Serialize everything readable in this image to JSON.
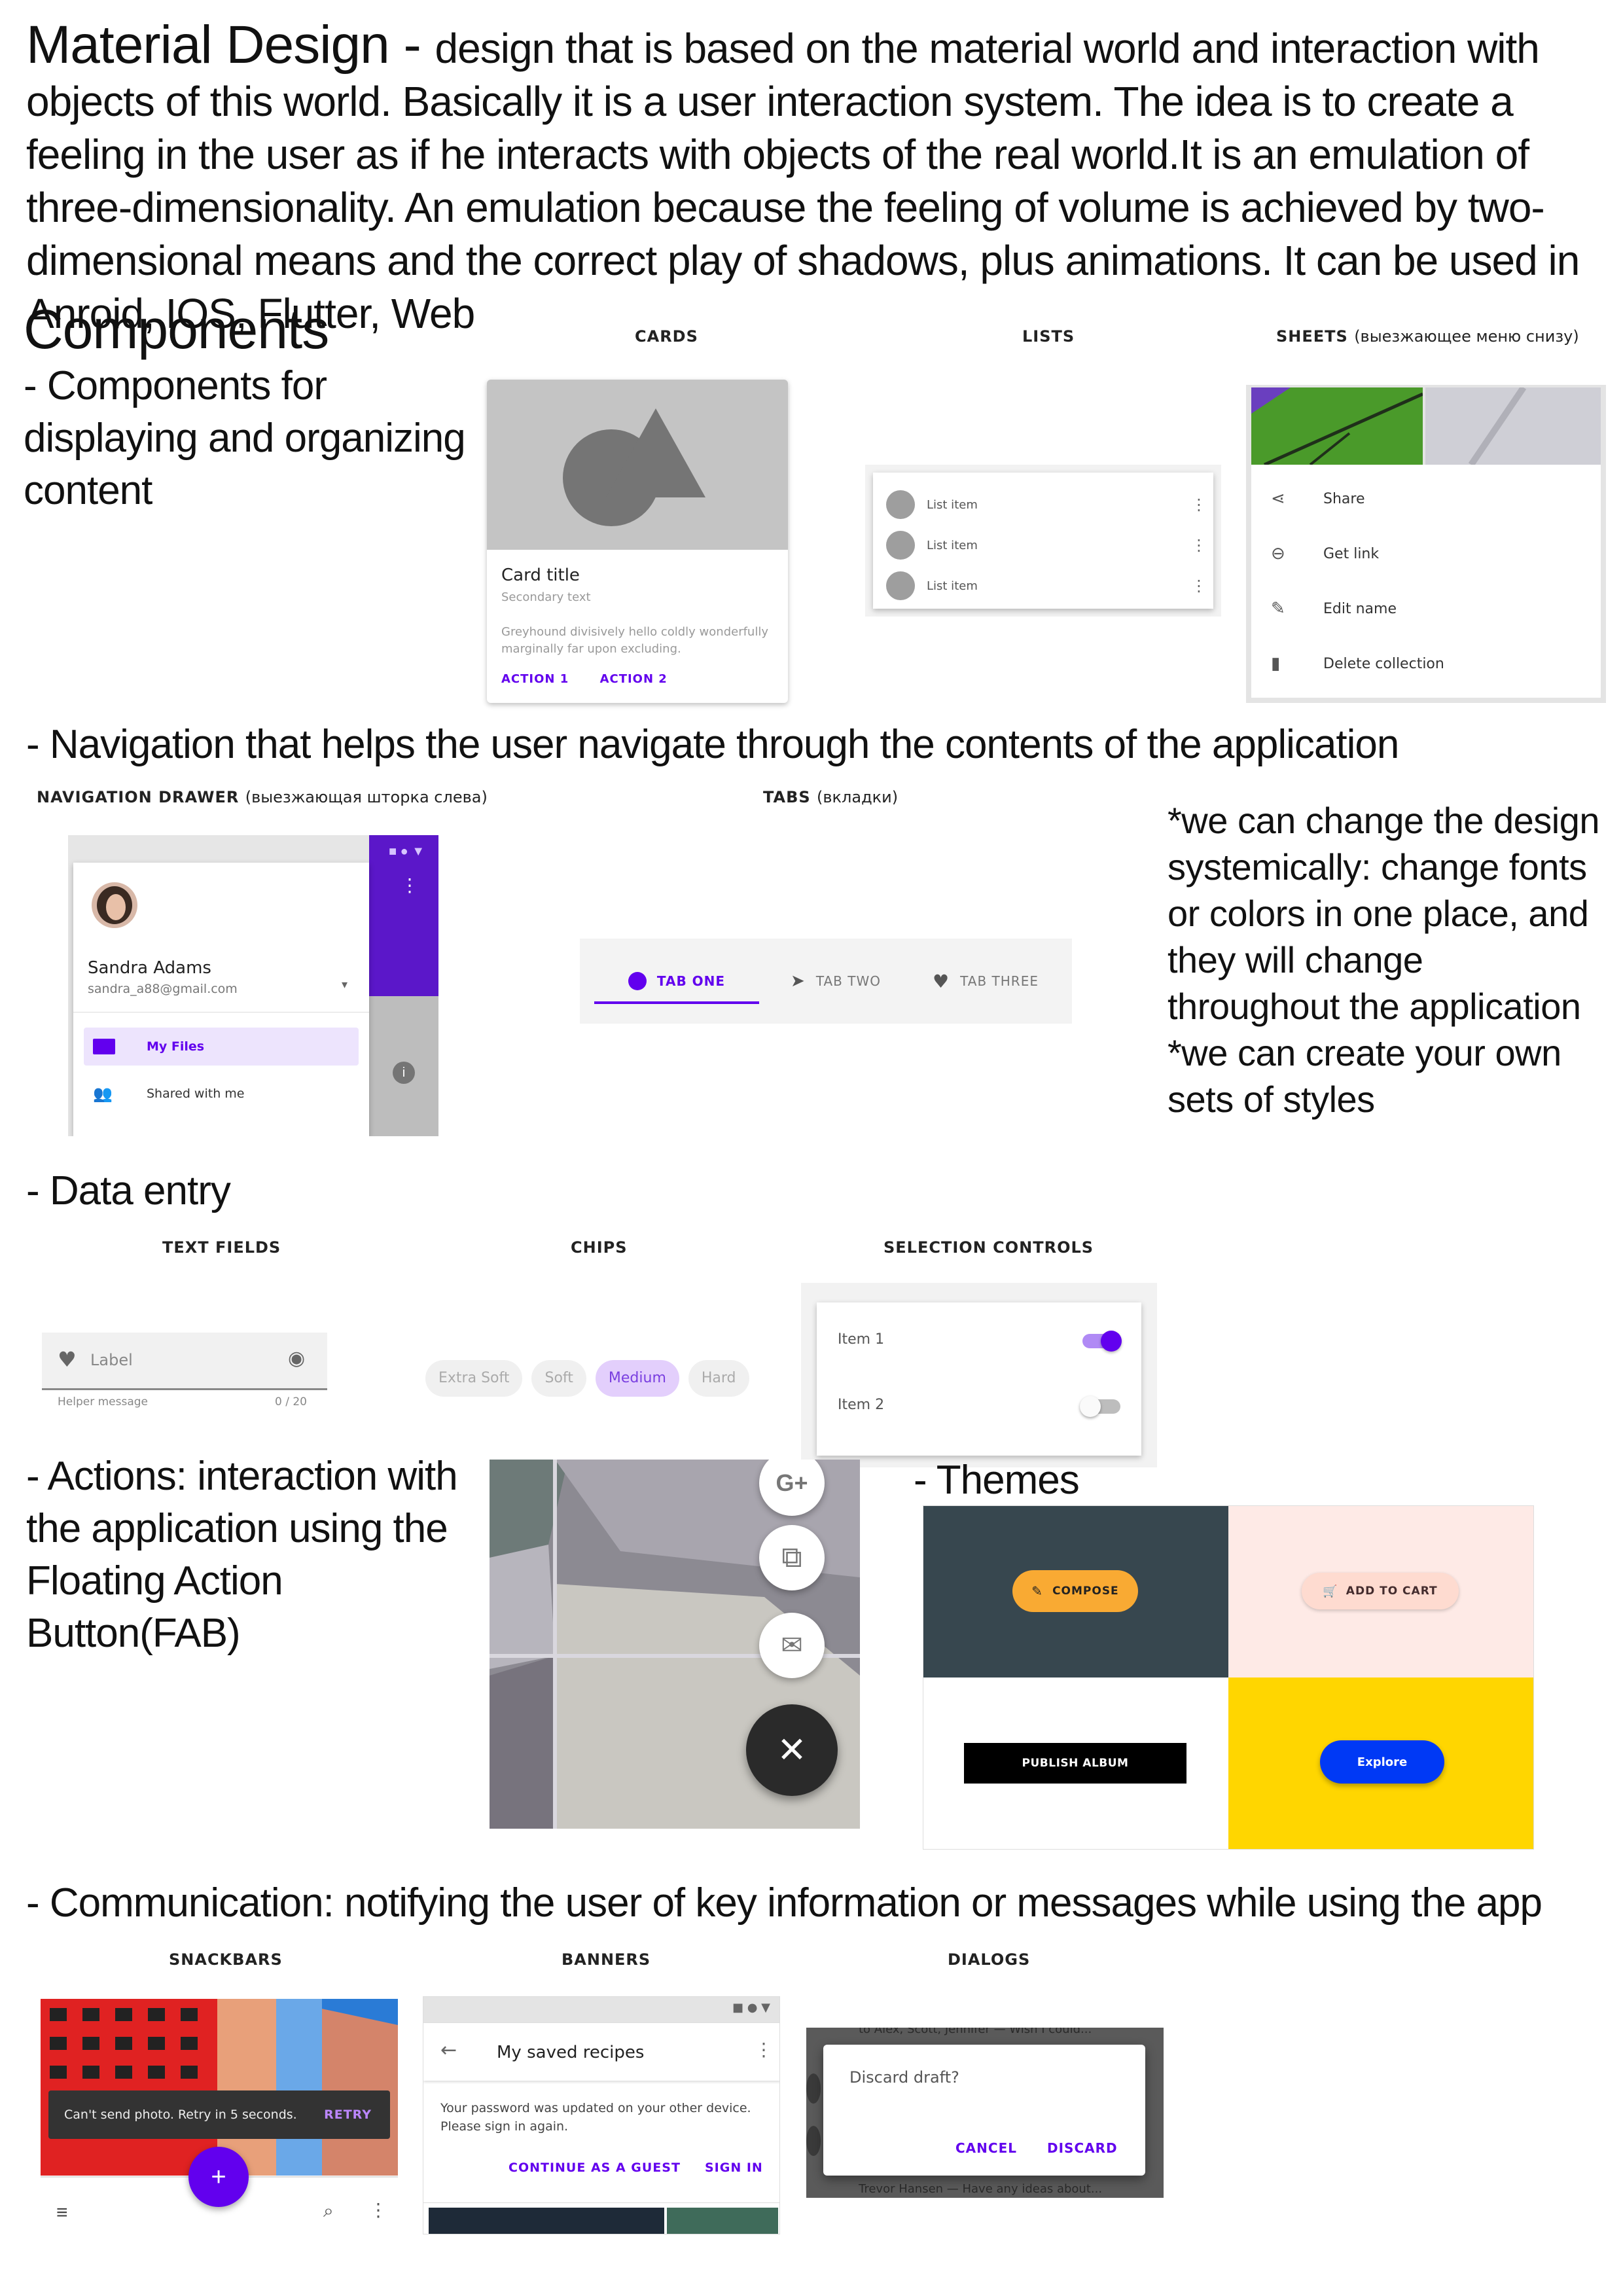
{
  "intro": {
    "heading": "Material Design - ",
    "text": "design that is based on the material world and interaction with objects of this world. Basically it is a user interaction system. The idea is to create a feeling in the user as if he interacts with objects of the real world.It is an emulation of three-dimensionality. An emulation because the feeling of volume is achieved by two-dimensional means and the correct play of shadows, plus animations. It can be used in Anroid, IOS, Flutter, Web"
  },
  "components": {
    "title": "Components",
    "desc": "- Components for displaying and organizing content",
    "cards": {
      "caption": "CARDS",
      "title": "Card title",
      "secondary": "Secondary text",
      "body": "Greyhound divisively hello coldly wonderfully marginally far upon excluding.",
      "action1": "ACTION 1",
      "action2": "ACTION 2"
    },
    "lists": {
      "caption": "LISTS",
      "items": [
        "List item",
        "List item",
        "List item"
      ]
    },
    "sheets": {
      "caption": "SHEETS",
      "caption_ru": "(выезжающее меню снизу)",
      "items": [
        "Share",
        "Get link",
        "Edit name",
        "Delete collection"
      ]
    }
  },
  "navigation": {
    "heading": "- Navigation that helps the user navigate through the contents of the application",
    "drawer": {
      "caption": "NAVIGATION DRAWER",
      "caption_ru": "(выезжающая шторка слева)",
      "name": "Sandra Adams",
      "email": "sandra_a88@gmail.com",
      "items": [
        "My Files",
        "Shared with me"
      ]
    },
    "tabs": {
      "caption": "TABS",
      "caption_ru": "(вкладки)",
      "items": [
        "TAB ONE",
        "TAB TWO",
        "TAB THREE"
      ]
    },
    "note": "*we can change the design systemically: change fonts or colors in one place, and they will change throughout the application\n*we can create your own sets of styles"
  },
  "data_entry": {
    "heading": "- Data entry",
    "text_fields": {
      "caption": "TEXT FIELDS",
      "label": "Label",
      "helper": "Helper message",
      "counter": "0 / 20"
    },
    "chips": {
      "caption": "CHIPS",
      "items": [
        "Extra Soft",
        "Soft",
        "Medium",
        "Hard"
      ],
      "selected": "Medium"
    },
    "selection": {
      "caption": "SELECTION CONTROLS",
      "items": [
        {
          "label": "Item 1",
          "on": true
        },
        {
          "label": "Item 2",
          "on": false
        }
      ]
    }
  },
  "actions": {
    "heading": "- Actions: interaction with the application using the Floating Action Button(FAB)",
    "fab_icons": [
      "google-plus-icon",
      "copy-icon",
      "mail-icon",
      "close-icon"
    ]
  },
  "themes": {
    "heading": "- Themes",
    "buttons": [
      "COMPOSE",
      "ADD TO CART",
      "PUBLISH ALBUM",
      "Explore"
    ],
    "colors": {
      "slate": "#37474F",
      "peach": "#FEEAE6",
      "yellow": "#FFD600",
      "orange": "#F9AA33",
      "blue": "#0039F5",
      "purple": "#6200EE"
    }
  },
  "communication": {
    "heading": "- Communication: notifying the user of key information or messages while using the app",
    "snackbars": {
      "caption": "SNACKBARS",
      "message": "Can't send photo. Retry in 5 seconds.",
      "action": "RETRY"
    },
    "banners": {
      "caption": "BANNERS",
      "title": "My saved recipes",
      "message": "Your password was updated on your other device. Please sign in again.",
      "action1": "CONTINUE AS A GUEST",
      "action2": "SIGN IN"
    },
    "dialogs": {
      "caption": "DIALOGS",
      "bg_top": "to Alex, Scott, Jennifer — Wish I could...",
      "bg_bottom": "Trevor Hansen — Have any ideas about...",
      "title": "Discard draft?",
      "cancel": "CANCEL",
      "discard": "DISCARD"
    }
  }
}
